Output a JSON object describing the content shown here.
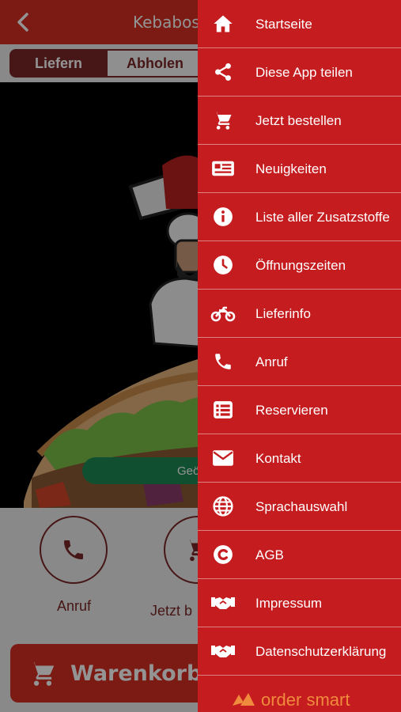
{
  "header": {
    "title": "Kebaboss"
  },
  "order_mode": {
    "deliver_label": "Liefern",
    "pickup_label": "Abholen"
  },
  "status_pill": {
    "text": "Geö"
  },
  "actions": {
    "call_label": "Anruf",
    "order_label": "Jetzt b"
  },
  "cart": {
    "label": "Warenkorb"
  },
  "drawer": {
    "items": [
      {
        "label": "Startseite",
        "icon": "home-icon"
      },
      {
        "label": "Diese App teilen",
        "icon": "share-icon"
      },
      {
        "label": "Jetzt bestellen",
        "icon": "cart-icon"
      },
      {
        "label": "Neuigkeiten",
        "icon": "news-icon"
      },
      {
        "label": "Liste aller Zusatzstoffe",
        "icon": "info-icon"
      },
      {
        "label": "Öffnungszeiten",
        "icon": "clock-icon"
      },
      {
        "label": "Lieferinfo",
        "icon": "motorbike-icon"
      },
      {
        "label": "Anruf",
        "icon": "phone-icon"
      },
      {
        "label": "Reservieren",
        "icon": "list-icon"
      },
      {
        "label": "Kontakt",
        "icon": "mail-icon"
      },
      {
        "label": "Sprachauswahl",
        "icon": "globe-icon"
      },
      {
        "label": "AGB",
        "icon": "copyright-icon"
      },
      {
        "label": "Impressum",
        "icon": "handshake-icon"
      },
      {
        "label": "Datenschutzerklärung",
        "icon": "handshake-icon"
      }
    ],
    "brand": "order smart"
  },
  "colors": {
    "primary": "#d42f24",
    "drawer": "#c41c1f",
    "accent": "#7a2727",
    "open": "#1c8a55",
    "brand": "#f08a3c"
  }
}
